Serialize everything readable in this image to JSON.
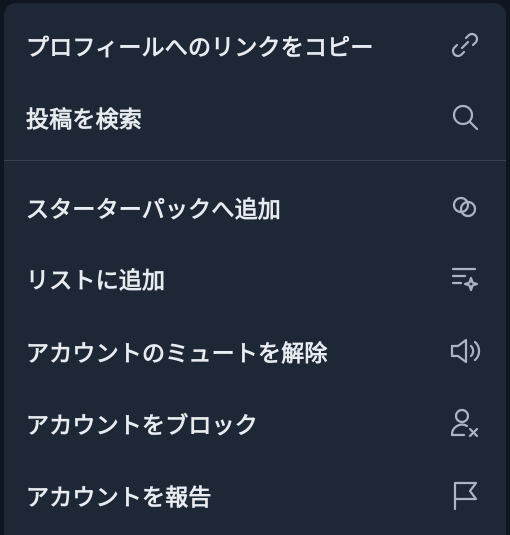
{
  "menu": {
    "items": [
      {
        "label": "プロフィールへのリンクをコピー",
        "icon": "link-icon"
      },
      {
        "label": "投稿を検索",
        "icon": "search-icon"
      },
      {
        "label": "スターターパックへ追加",
        "icon": "starter-pack-icon"
      },
      {
        "label": "リストに追加",
        "icon": "list-add-icon"
      },
      {
        "label": "アカウントのミュートを解除",
        "icon": "speaker-icon"
      },
      {
        "label": "アカウントをブロック",
        "icon": "user-block-icon"
      },
      {
        "label": "アカウントを報告",
        "icon": "flag-icon"
      }
    ]
  },
  "colors": {
    "background": "#1e2736",
    "text": "#e8ebef",
    "icon": "#aab5c3",
    "divider": "#364253"
  }
}
